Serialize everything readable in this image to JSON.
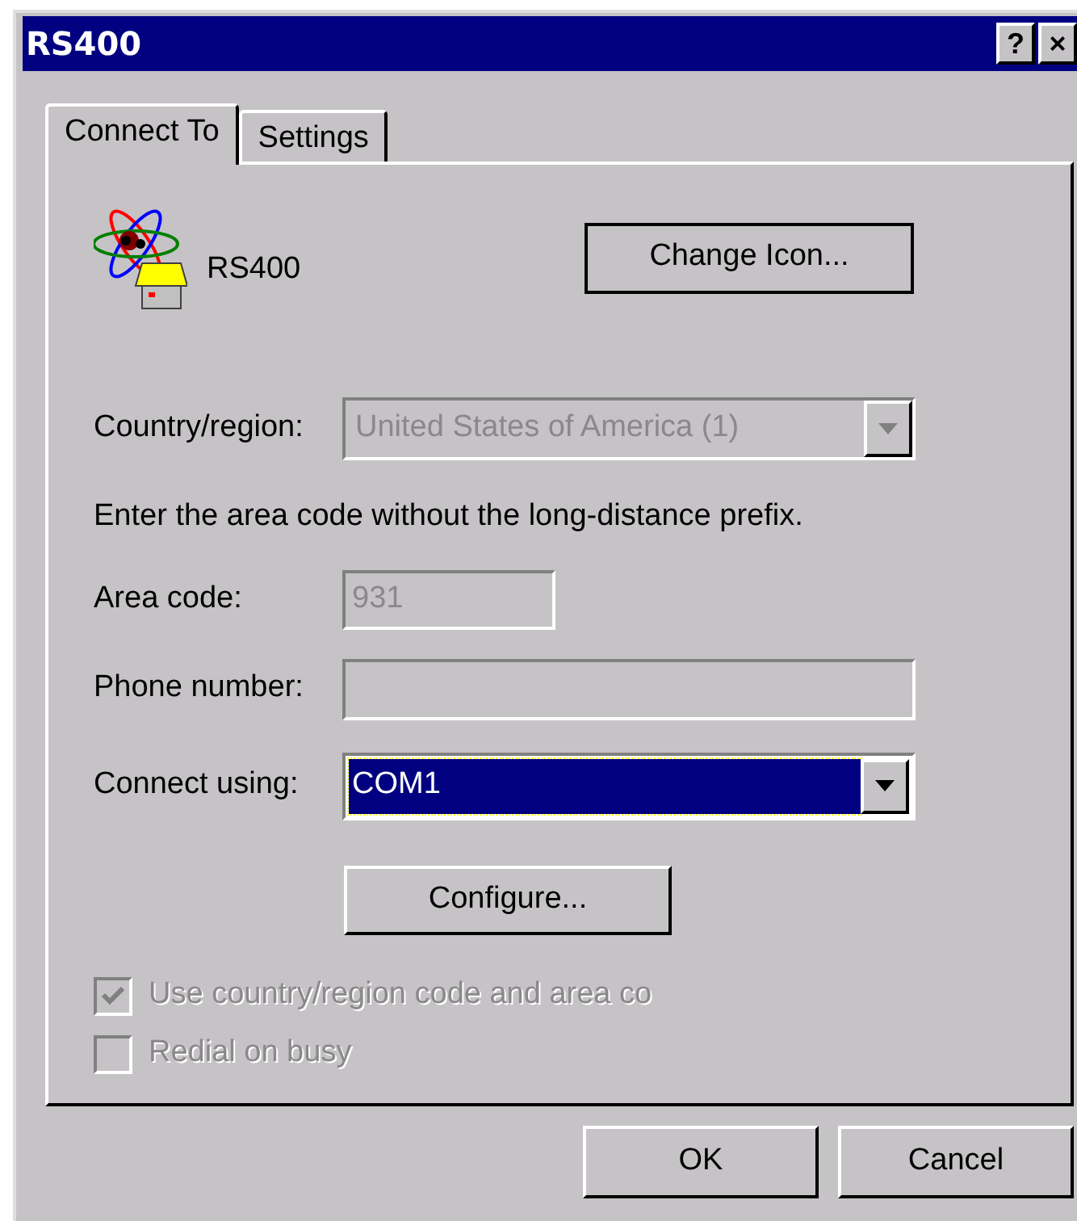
{
  "window": {
    "title": "RS400",
    "title_buttons": [
      "?",
      "×"
    ]
  },
  "tabs": [
    {
      "label": "Connect To",
      "selected": true
    },
    {
      "label": "Settings",
      "selected": false
    }
  ],
  "connection": {
    "name": "RS400",
    "change_icon_button": "Change Icon..."
  },
  "country": {
    "label": "Country/region:",
    "value": "United States of America (1)",
    "disabled": true
  },
  "hint": "Enter the area code without the long-distance prefix.",
  "area_code": {
    "label": "Area code:",
    "value": "931",
    "disabled": true
  },
  "phone_number": {
    "label": "Phone number:",
    "disabled": true
  },
  "connect_using": {
    "label": "Connect using:",
    "value": "COM1",
    "disabled": false,
    "focused": true
  },
  "configure_button": "Configure...",
  "options": [
    {
      "label": "Use country/region code and area co",
      "checked": true,
      "disabled": true
    },
    {
      "label": "Redial on busy",
      "checked": false,
      "disabled": true
    }
  ],
  "buttons": [
    "OK",
    "Cancel"
  ]
}
